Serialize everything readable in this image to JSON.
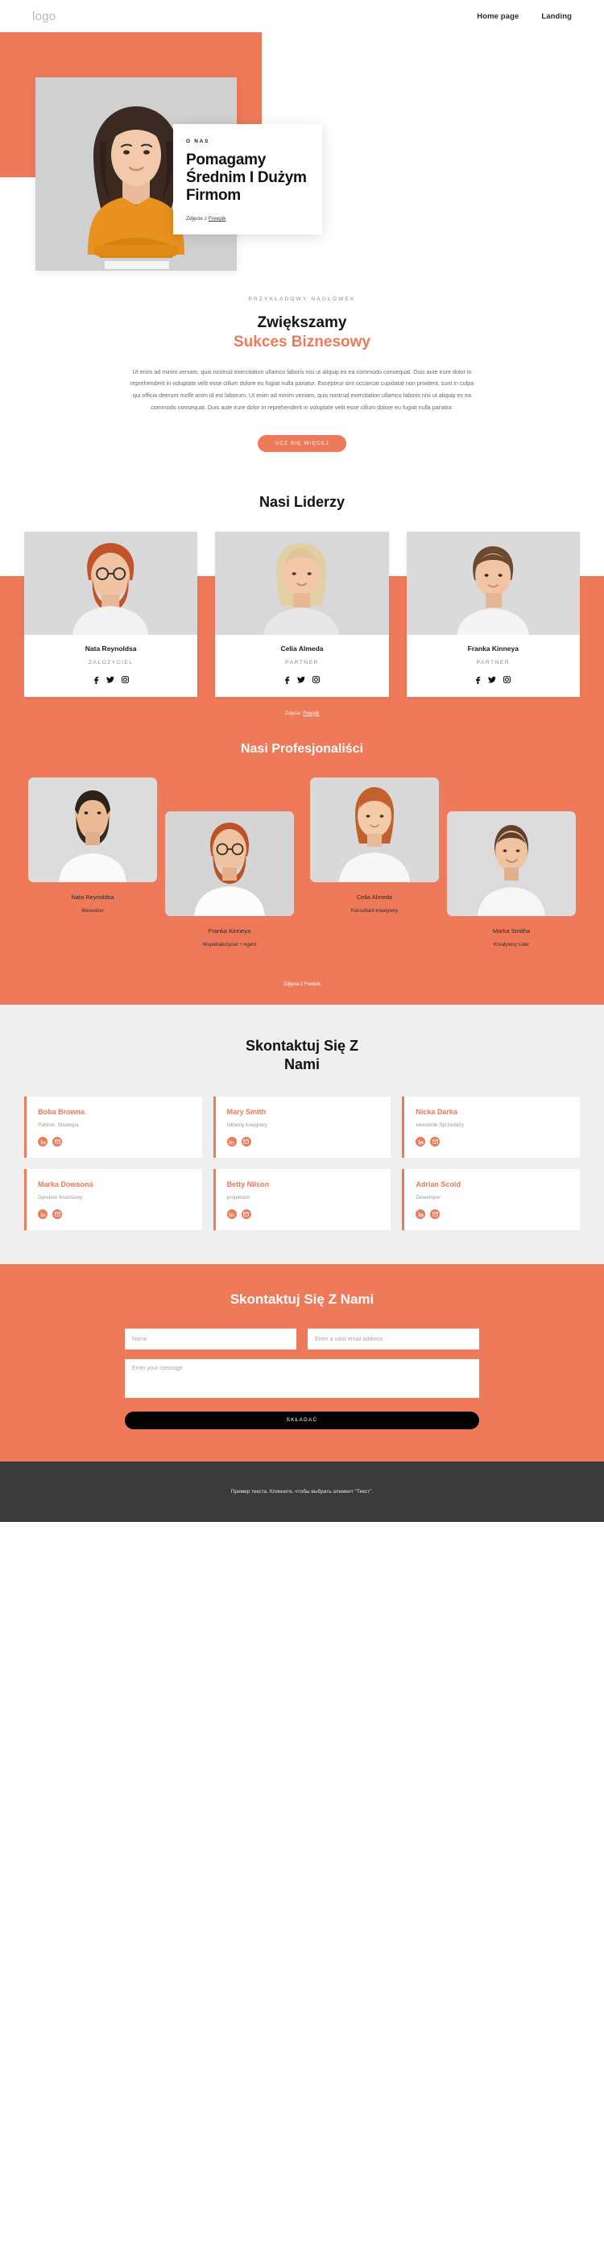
{
  "header": {
    "logo": "logo",
    "nav": [
      {
        "label": "Home page"
      },
      {
        "label": "Landing"
      }
    ]
  },
  "hero": {
    "kicker": "O NAS",
    "title": "Pomagamy Średnim I Dużym Firmom",
    "credit_prefix": "Zdjęcie z ",
    "credit_link": "Freepik"
  },
  "intro": {
    "kicker": "PRZYKŁADOWY NAGŁÓWEK",
    "title_line1": "Zwiększamy",
    "title_line2": "Sukces Biznesowy",
    "paragraph": "Ut enim ad minim veniam, quis nostrud exercitation ullamco laboris nisi ut aliquip ex ea commodo consequat. Duis aute irure dolor in reprehenderit in voluptate velit esse cillum dolore eu fugiat nulla pariatur. Excepteur sint occaecat cupidatat non proident, sunt in culpa qui officia deerunt mollit anim id est laborum. Ut enim ad minim veniam, quis nostrud exercitation ullamco laboris nisi ut aliquip ex ea commodo consequat. Duis aute irure dolor in reprehenderit in voluptate velit esse cillum dolore eu fugiat nulla pariatur.",
    "button": "UCZ SIĘ WIĘCEJ"
  },
  "leaders": {
    "heading": "Nasi Liderzy",
    "credit_prefix": "Zdjęcie: ",
    "credit_link": "Freepik",
    "items": [
      {
        "name": "Nata Reynoldsa",
        "role": "ZAŁOŻYCIEL"
      },
      {
        "name": "Celia Almeda",
        "role": "PARTNER"
      },
      {
        "name": "Franka Kinneya",
        "role": "PARTNER"
      }
    ]
  },
  "pros": {
    "heading": "Nasi Profesjonaliści",
    "credit": "Zdjęcia z Freepik",
    "items": [
      {
        "name": "Nata Reynoldsa",
        "role": "Menedżer"
      },
      {
        "name": "Franka Kinneya",
        "role": "Współzałożyciel + Agent"
      },
      {
        "name": "Celia Almeda",
        "role": "Konsultant kreatywny"
      },
      {
        "name": "Marka Smitha",
        "role": "Kreatywny Lider"
      }
    ]
  },
  "contacts": {
    "heading_line1": "Skontaktuj Się Z",
    "heading_line2": "Nami",
    "cards": [
      {
        "name": "Boba Browna",
        "role": "Partner, Strategia"
      },
      {
        "name": "Mary Smith",
        "role": "Główny księgowy"
      },
      {
        "name": "Nicka Darka",
        "role": "kierownik Sprzedaży"
      },
      {
        "name": "Marka Dowsona",
        "role": "Dyrektor finansowy"
      },
      {
        "name": "Betty Nilson",
        "role": "projektant"
      },
      {
        "name": "Adrian Scold",
        "role": "Deweloper"
      }
    ]
  },
  "form": {
    "heading": "Skontaktuj Się Z Nami",
    "name_placeholder": "Name",
    "email_placeholder": "Enter a valid email address",
    "message_placeholder": "Enter your message",
    "submit": "SKŁADAĆ"
  },
  "footer": {
    "text": "Пример текста. Кликните, чтобы выбрать элемент \"Текст\"."
  },
  "colors": {
    "accent": "#ee7a5a",
    "dark": "#3a3a3a",
    "grey_bg": "#efefef"
  }
}
